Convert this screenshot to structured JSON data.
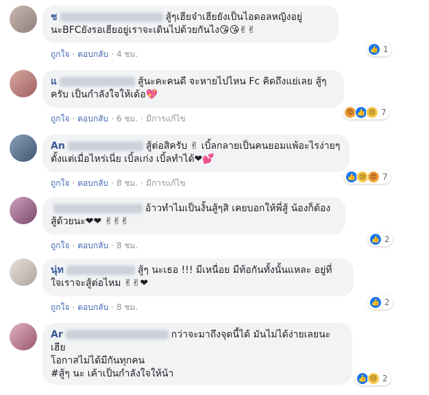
{
  "comments": [
    {
      "name": "ช",
      "text_line1": "สู้ๆเฮียจ๋าเฮียยังเป็นไอดอลหญิงอยู่",
      "text_line2": "นะBFCยังรอเฮียอยู่เราจะเดินไปด้วยกันไง😘😘✌✌",
      "like": "ถูกใจ",
      "reply": "ตอบกลับ",
      "time": "4 ชม.",
      "edited": "",
      "reactions": [
        "like"
      ],
      "count": "1"
    },
    {
      "name": "แ",
      "text_line1": "สู้นะคะคนดี จะหายไปไหน Fc คิดถึงแย่เลย สู้ๆ",
      "text_line2": "ครับ เป็นกำลังใจให้เด้อ💖",
      "like": "ถูกใจ",
      "reply": "ตอบกลับ",
      "time": "6 ชม.",
      "edited": "มีการแก้ไข",
      "reactions": [
        "angry",
        "like",
        "sad"
      ],
      "count": "7"
    },
    {
      "name": "An",
      "text_line1": "สู้ต่อสิครับ ✌ เบิ้ลกลายเป็นคนยอมแพ้อะไรง่ายๆ",
      "text_line2": "ตั้งแต่เมื่อไหร่เนี่ย เบิ้ลเก่ง เบิ้ลทำได้❤💕",
      "like": "ถูกใจ",
      "reply": "ตอบกลับ",
      "time": "8 ชม.",
      "edited": "มีการแก้ไข",
      "reactions": [
        "like",
        "sad",
        "angry"
      ],
      "count": "7"
    },
    {
      "name": "",
      "text_line1": "อ้าวทำไมเป็นงั้นสู้ๆสิ เคยบอกให้พี่สู้ น้องก็ต้อง",
      "text_line2": "สู้ด้วยนะ❤❤ ✌✌✌",
      "like": "ถูกใจ",
      "reply": "ตอบกลับ",
      "time": "8 ชม.",
      "edited": "",
      "reactions": [
        "like"
      ],
      "count": "2"
    },
    {
      "name": "นุ่ท",
      "text_line1": "สู้ๆ นะเธอ !!! มีเหนื่อย มีท้อกันทั้งนั้นแหละ อยู่ที่",
      "text_line2": "ใจเราจะสู้ต่อไหม ✌✌❤",
      "like": "ถูกใจ",
      "reply": "ตอบกลับ",
      "time": "8 ชม.",
      "edited": "",
      "reactions": [
        "like"
      ],
      "count": "2"
    },
    {
      "name": "Ar",
      "text_line1": "กว่าจะมาถึงจุดนี้ได้ มันไม่ได้ง่ายเลยนะเฮีย",
      "text_line2": "โอกาสไม่ได้มีกันทุกคน",
      "text_line3": "#สู้ๆ นะ เค้าเป็นกำลังใจให้น้า",
      "like": "",
      "reply": "",
      "time": "",
      "edited": "",
      "reactions": [
        "like",
        "sad"
      ],
      "count": "2"
    }
  ],
  "reaction_icons": {
    "like": "👍",
    "angry": "😡",
    "sad": "😢"
  },
  "colors": {
    "name": "#385898",
    "link": "#4267b2",
    "bubble": "#f2f3f5",
    "meta": "#90949c"
  }
}
